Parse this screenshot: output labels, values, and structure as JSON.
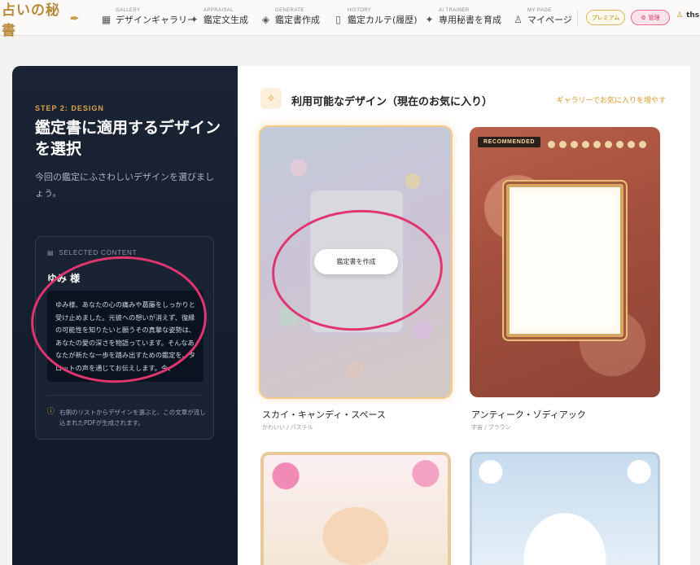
{
  "header": {
    "logo_text": "占いの秘書",
    "nav": [
      {
        "sub": "GALLERY",
        "label": "デザインギャラリー",
        "icon": "grid-icon"
      },
      {
        "sub": "APPRAISAL",
        "label": "鑑定文生成",
        "icon": "sparkle-icon"
      },
      {
        "sub": "GENERATE",
        "label": "鑑定書作成",
        "icon": "tag-icon"
      },
      {
        "sub": "HISTORY",
        "label": "鑑定カルテ(履歴)",
        "icon": "book-icon"
      },
      {
        "sub": "AI TRAINER",
        "label": "専用秘書を育成",
        "icon": "sparkle-icon"
      },
      {
        "sub": "MY PAGE",
        "label": "マイページ",
        "icon": "user-icon"
      }
    ],
    "premium_label": "プレミアム",
    "admin_label": "管理",
    "user_name": "ths"
  },
  "left": {
    "step": "STEP 2: DESIGN",
    "title": "鑑定書に適用するデザインを選択",
    "description": "今回の鑑定にふさわしいデザインを選びましょう。",
    "selected": {
      "label": "SELECTED CONTENT",
      "name": "ゆみ 様",
      "text": "ゆみ様、あなたの心の痛みや葛藤をしっかりと受け止めました。元彼への想いが消えず、復縁の可能性を知りたいと願うその真摯な姿勢は、あなたの愛の深さを物語っています。そんなあなたが新たな一歩を踏み出すための鑑定を、タロットの声を通じてお伝えします。今、",
      "note": "右側のリストからデザインを選ぶと、この文章が流し込まれたPDFが生成されます。"
    }
  },
  "right": {
    "section_title": "利用可能なデザイン（現在のお気に入り）",
    "gallery_link": "ギャラリーでお気に入りを増やす",
    "create_label": "鑑定書を作成",
    "recommended_label": "RECOMMENDED",
    "designs": [
      {
        "name": "スカイ・キャンディ・スペース",
        "tags": "かわいい / パステル"
      },
      {
        "name": "アンティーク・ゾディアック",
        "tags": "宇宙 / ブラウン"
      },
      {
        "name": "",
        "tags": ""
      },
      {
        "name": "",
        "tags": ""
      }
    ]
  },
  "colors": {
    "accent": "#e09a33",
    "annotation": "#e0356e",
    "panel_dark": "#151e2d"
  }
}
